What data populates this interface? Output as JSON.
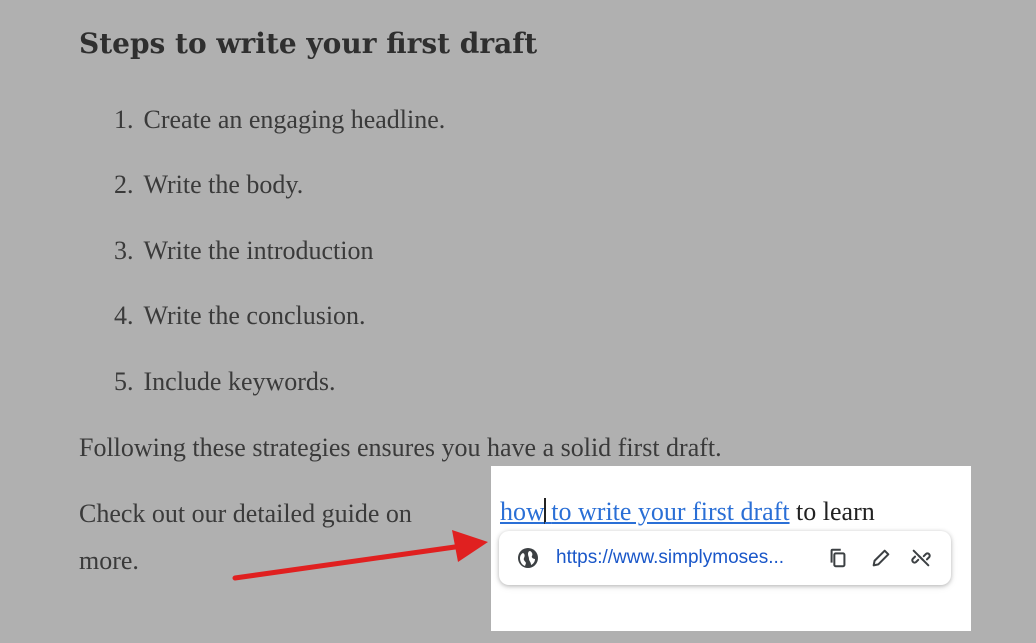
{
  "document": {
    "heading": "Steps to write your first draft",
    "steps": [
      {
        "num": "1.",
        "text": "Create an engaging headline."
      },
      {
        "num": "2.",
        "text": "Write the body."
      },
      {
        "num": "3.",
        "text": "Write the introduction"
      },
      {
        "num": "4.",
        "text": "Write the conclusion."
      },
      {
        "num": "5.",
        "text": "Include keywords."
      }
    ],
    "paragraph1": "Following these strategies ensures you have a solid first draft.",
    "paragraph2_prefix": "Check out our detailed guide on",
    "paragraph2_suffix": "more."
  },
  "link_popup": {
    "link_text_part1": "how",
    "link_text_part2": "to write your first draft",
    "after_link_text": "to learn",
    "url": "https://www.simplymoses...",
    "icons": {
      "globe": "globe-icon",
      "copy": "copy-icon",
      "edit": "pencil-icon",
      "unlink": "unlink-icon"
    }
  },
  "colors": {
    "overlay_bg": "#b0b0b0",
    "link": "#2a6fd6",
    "url": "#1a57c9",
    "arrow": "#e02020"
  }
}
